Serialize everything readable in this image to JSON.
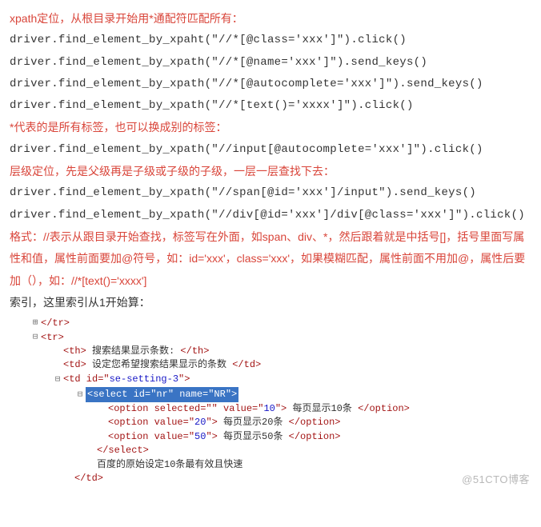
{
  "lines": {
    "l1": "xpath定位，从根目录开始用*通配符匹配所有：",
    "l2": "driver.find_element_by_xpaht(\"//*[@class='xxx']\").click()",
    "l3": "driver.find_element_by_xpath(\"//*[@name='xxx']\").send_keys()",
    "l4": "driver.find_element_by_xpath(\"//*[@autocomplete='xxx']\").send_keys()",
    "l5": "driver.find_element_by_xpath(\"//*[text()='xxxx']\").click()",
    "l6": "*代表的是所有标签，也可以换成别的标签：",
    "l7": "driver.find_element_by_xpath(\"//input[@autocomplete='xxx']\").click()",
    "l8": "层级定位，先是父级再是子级或子级的子级，一层一层查找下去：",
    "l9": "driver.find_element_by_xpath(\"//span[@id='xxx']/input\").send_keys()",
    "l10": "driver.find_element_by_xpath(\"//div[@id='xxx']/div[@class='xxx']\").click()",
    "l11": "格式：//表示从跟目录开始查找，标签写在外面，如span、div、*，然后跟着就是中括号[]，括号里面写属性和值，属性前面要加@符号，如：id='xxx'，class='xxx'，如果模糊匹配，属性前面不用加@，属性后要加（），如：//*[text()='xxxx']",
    "l12": "索引，这里索引从1开始算："
  },
  "snippet": {
    "r1": "</tr>",
    "r2": "<tr>",
    "r3_open": "<th>",
    "r3_txt": " 搜索结果显示条数: ",
    "r3_close": "</th>",
    "r4_open": "<td>",
    "r4_txt": " 设定您希望搜索结果显示的条数 ",
    "r4_close": "</td>",
    "r5_a": "<td id=\"",
    "r5_b": "se-setting-3",
    "r5_c": "\">",
    "r6": "<select id=\"nr\" name=\"NR\">",
    "r7_a": "<option selected=\"\" value=\"",
    "r7_b": "10",
    "r7_c": "\">",
    "r7_txt": " 每页显示10条 ",
    "r7_d": "</option>",
    "r8_a": "<option value=\"",
    "r8_b": "20",
    "r8_c": "\">",
    "r8_txt": " 每页显示20条 ",
    "r8_d": "</option>",
    "r9_a": "<option value=\"",
    "r9_b": "50",
    "r9_c": "\">",
    "r9_txt": " 每页显示50条 ",
    "r9_d": "</option>",
    "r10": "</select>",
    "r11": "百度的原始设定10条最有效且快速",
    "r12": "</td>"
  },
  "watermark": "@51CTO博客"
}
